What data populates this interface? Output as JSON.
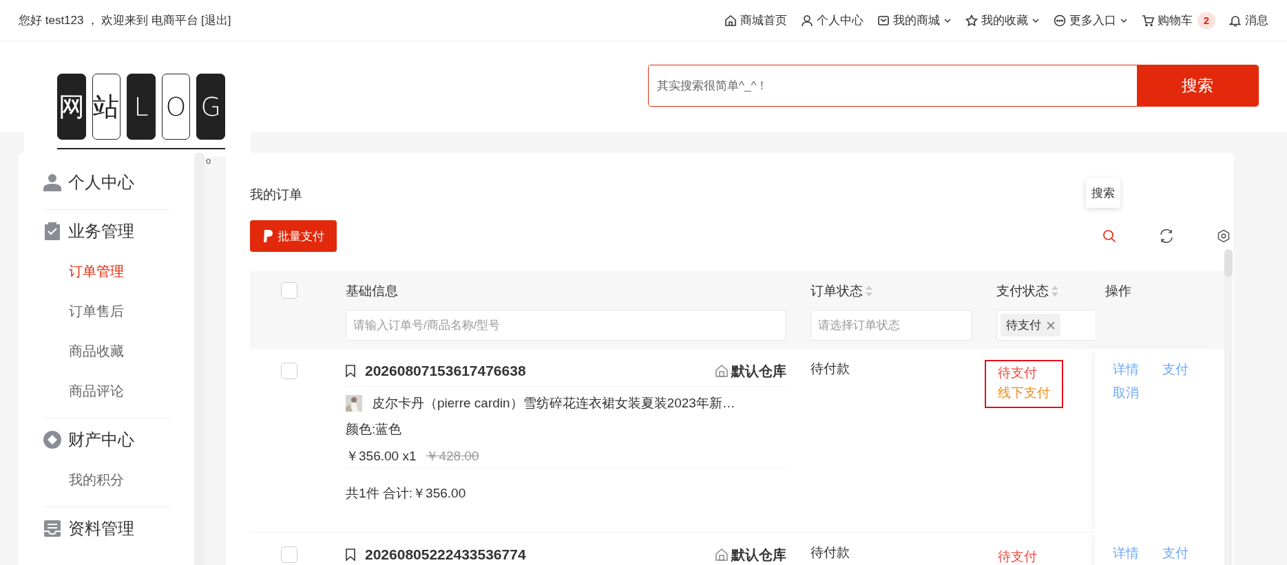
{
  "top_bar": {
    "greeting": "您好 test123 ，",
    "welcome": "欢迎来到 电商平台",
    "logout": "[退出]",
    "nav": [
      {
        "kind": "home",
        "label": "商城首页",
        "dropdown": false
      },
      {
        "kind": "user",
        "label": "个人中心",
        "dropdown": false
      },
      {
        "kind": "mail",
        "label": "我的商城",
        "dropdown": true
      },
      {
        "kind": "star",
        "label": "我的收藏",
        "dropdown": true
      },
      {
        "kind": "more",
        "label": "更多入口",
        "dropdown": true
      },
      {
        "kind": "cart",
        "label": "购物车",
        "dropdown": false,
        "badge": "2"
      },
      {
        "kind": "bell",
        "label": "消息",
        "dropdown": false
      }
    ]
  },
  "logo": {
    "tiles": [
      {
        "char": "网",
        "inverted": true
      },
      {
        "char": "站",
        "inverted": false
      },
      {
        "char": "L",
        "inverted": true
      },
      {
        "char": "O",
        "inverted": false
      },
      {
        "char": "G",
        "inverted": true
      }
    ]
  },
  "search": {
    "placeholder": "其实搜索很简单^_^！",
    "button": "搜索"
  },
  "stray_mark": "o",
  "sidebar": {
    "groups": [
      {
        "kind": "user",
        "title": "个人中心"
      },
      {
        "kind": "clipboard",
        "title": "业务管理",
        "items": [
          {
            "label": "订单管理",
            "selected": true
          },
          {
            "label": "订单售后",
            "selected": false
          },
          {
            "label": "商品收藏",
            "selected": false
          },
          {
            "label": "商品评论",
            "selected": false
          }
        ]
      },
      {
        "kind": "diamond",
        "title": "财产中心",
        "items": [
          {
            "label": "我的积分",
            "selected": false
          }
        ]
      },
      {
        "kind": "archive",
        "title": "资料管理"
      }
    ]
  },
  "main": {
    "title": "我的订单",
    "bulk_pay_button": "批量支付",
    "tooltip": "搜索",
    "table": {
      "select_all": false,
      "columns": [
        {
          "title": "基础信息",
          "sortable": false,
          "filter": {
            "kind": "input",
            "placeholder": "请输入订单号/商品名称/型号"
          }
        },
        {
          "title": "订单状态",
          "sortable": true,
          "filter": {
            "kind": "select",
            "placeholder": "请选择订单状态"
          }
        },
        {
          "title": "支付状态",
          "sortable": true,
          "filter": {
            "kind": "tags",
            "tags": [
              "待支付"
            ]
          }
        },
        {
          "title": "操作",
          "sortable": false
        }
      ],
      "rows": [
        {
          "checked": false,
          "order_no": "20260807153617476638",
          "warehouse": "默认仓库",
          "product": {
            "name": "皮尔卡丹（pierre cardin）雪纺碎花连衣裙女装夏装2023年新…",
            "spec": "颜色:蓝色",
            "price": "￥356.00 x1",
            "original_price": "￥428.00"
          },
          "summary": "共1件 合计:￥356.00",
          "order_status": "待付款",
          "pay_status": [
            {
              "label": "待支付",
              "color": "#f04a3f"
            },
            {
              "label": "线下支付",
              "color": "#f08a1c"
            }
          ],
          "highlighted": true,
          "actions": [
            "详情",
            "支付",
            "取消"
          ]
        },
        {
          "checked": false,
          "order_no": "20260805222433536774",
          "warehouse": "默认仓库",
          "order_status": "待付款",
          "pay_status": [
            {
              "label": "待支付",
              "color": "#f04a3f"
            }
          ],
          "highlighted": false,
          "actions": [
            "详情",
            "支付"
          ]
        }
      ]
    }
  }
}
